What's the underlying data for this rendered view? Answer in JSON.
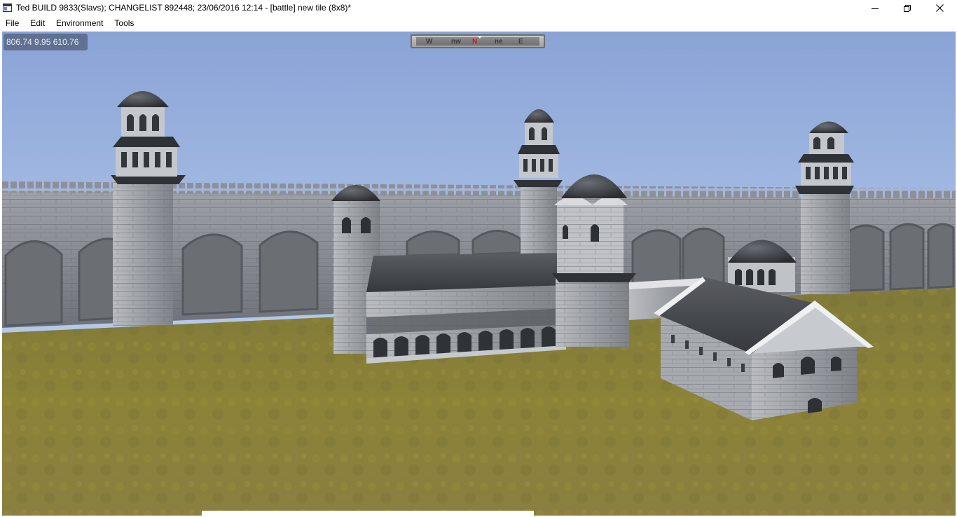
{
  "window": {
    "title": "Ted BUILD 9833(Slavs); CHANGELIST 892448; 23/06/2016 12:14 - [battle] new tile (8x8)*",
    "app_icon": "window-app-icon",
    "controls": [
      "minimize-icon",
      "restore-icon",
      "close-icon"
    ]
  },
  "menubar": {
    "items": [
      "File",
      "Edit",
      "Environment",
      "Tools"
    ]
  },
  "viewport": {
    "coords_readout": "806.74  9.95  610.76",
    "compass": {
      "labels": [
        "W",
        "nw",
        "N",
        "ne",
        "E"
      ],
      "north_color": "#d21a1a"
    },
    "colors": {
      "sky_top": "#8fa8d8",
      "sky_bottom": "#c7d7ee",
      "ground": "#8a7f37",
      "stone": "#9a9da3",
      "roof": "#3f4246"
    }
  }
}
